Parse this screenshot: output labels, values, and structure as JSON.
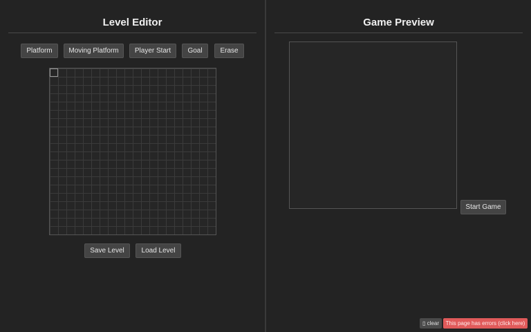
{
  "editor": {
    "title": "Level Editor",
    "tools": {
      "platform": "Platform",
      "moving_platform": "Moving Platform",
      "player_start": "Player Start",
      "goal": "Goal",
      "erase": "Erase"
    },
    "save_label": "Save Level",
    "load_label": "Load Level"
  },
  "preview": {
    "title": "Game Preview",
    "start_label": "Start Game"
  },
  "error_bar": {
    "clear_label": "▯ clear",
    "message": "This page has errors (click here)",
    "color": "#e05a5a"
  }
}
